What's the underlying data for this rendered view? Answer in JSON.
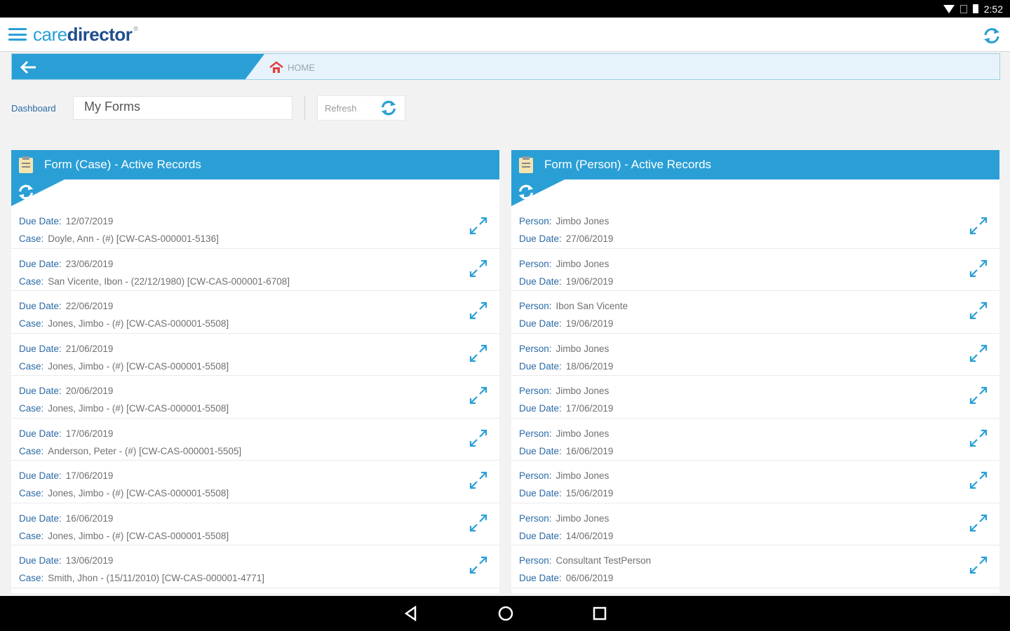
{
  "status_bar": {
    "time": "2:52"
  },
  "app": {
    "logo_part1": "care",
    "logo_part2": "director",
    "logo_mark": "®"
  },
  "breadcrumb": {
    "home_label": "HOME"
  },
  "toolbar": {
    "dashboard_label": "Dashboard",
    "dashboard_value": "My Forms",
    "refresh_label": "Refresh"
  },
  "colors": {
    "accent": "#2a9fd6",
    "label_blue": "#2a6aa6",
    "brand_dark": "#1f4e8c"
  },
  "left_panel": {
    "title": "Form (Case) - Active Records",
    "rows": [
      {
        "k1": "Due Date:",
        "v1": "12/07/2019",
        "k2": "Case:",
        "v2": "Doyle, Ann - (#) [CW-CAS-000001-5136]"
      },
      {
        "k1": "Due Date:",
        "v1": "23/06/2019",
        "k2": "Case:",
        "v2": "San Vicente, Ibon - (22/12/1980) [CW-CAS-000001-6708]"
      },
      {
        "k1": "Due Date:",
        "v1": "22/06/2019",
        "k2": "Case:",
        "v2": "Jones, Jimbo - (#) [CW-CAS-000001-5508]"
      },
      {
        "k1": "Due Date:",
        "v1": "21/06/2019",
        "k2": "Case:",
        "v2": "Jones, Jimbo - (#) [CW-CAS-000001-5508]"
      },
      {
        "k1": "Due Date:",
        "v1": "20/06/2019",
        "k2": "Case:",
        "v2": "Jones, Jimbo - (#) [CW-CAS-000001-5508]"
      },
      {
        "k1": "Due Date:",
        "v1": "17/06/2019",
        "k2": "Case:",
        "v2": "Anderson, Peter - (#) [CW-CAS-000001-5505]"
      },
      {
        "k1": "Due Date:",
        "v1": "17/06/2019",
        "k2": "Case:",
        "v2": "Jones, Jimbo - (#) [CW-CAS-000001-5508]"
      },
      {
        "k1": "Due Date:",
        "v1": "16/06/2019",
        "k2": "Case:",
        "v2": "Jones, Jimbo - (#) [CW-CAS-000001-5508]"
      },
      {
        "k1": "Due Date:",
        "v1": "13/06/2019",
        "k2": "Case:",
        "v2": "Smith, Jhon - (15/11/2010) [CW-CAS-000001-4771]"
      }
    ]
  },
  "right_panel": {
    "title": "Form (Person) - Active Records",
    "rows": [
      {
        "k1": "Person:",
        "v1": "Jimbo Jones",
        "k2": "Due Date:",
        "v2": "27/06/2019"
      },
      {
        "k1": "Person:",
        "v1": "Jimbo Jones",
        "k2": "Due Date:",
        "v2": "19/06/2019"
      },
      {
        "k1": "Person:",
        "v1": "Ibon San Vicente",
        "k2": "Due Date:",
        "v2": "19/06/2019"
      },
      {
        "k1": "Person:",
        "v1": "Jimbo Jones",
        "k2": "Due Date:",
        "v2": "18/06/2019"
      },
      {
        "k1": "Person:",
        "v1": "Jimbo Jones",
        "k2": "Due Date:",
        "v2": "17/06/2019"
      },
      {
        "k1": "Person:",
        "v1": "Jimbo Jones",
        "k2": "Due Date:",
        "v2": "16/06/2019"
      },
      {
        "k1": "Person:",
        "v1": "Jimbo Jones",
        "k2": "Due Date:",
        "v2": "15/06/2019"
      },
      {
        "k1": "Person:",
        "v1": "Jimbo Jones",
        "k2": "Due Date:",
        "v2": "14/06/2019"
      },
      {
        "k1": "Person:",
        "v1": "Consultant TestPerson",
        "k2": "Due Date:",
        "v2": "06/06/2019"
      }
    ]
  }
}
